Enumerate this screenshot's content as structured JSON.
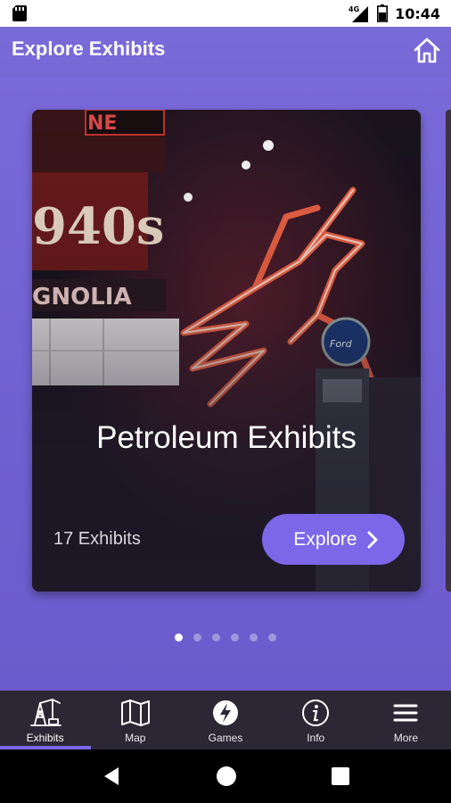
{
  "status_bar": {
    "time": "10:44",
    "network": "4G",
    "icons": [
      "sim-card-icon",
      "signal-icon",
      "battery-icon"
    ]
  },
  "app_bar": {
    "title": "Explore Exhibits",
    "home_icon": "home-icon"
  },
  "carousel": {
    "cards": [
      {
        "title": "Petroleum Exhibits",
        "count": "17 Exhibits",
        "button_label": "Explore",
        "image": "neon-pegasus-photo"
      }
    ],
    "pages": 6,
    "active_page": 0
  },
  "tab_bar": {
    "tabs": [
      {
        "label": "Exhibits",
        "icon": "oil-derrick-icon",
        "active": true
      },
      {
        "label": "Map",
        "icon": "map-icon",
        "active": false
      },
      {
        "label": "Games",
        "icon": "lightning-icon",
        "active": false
      },
      {
        "label": "Info",
        "icon": "info-icon",
        "active": false
      },
      {
        "label": "More",
        "icon": "menu-icon",
        "active": false
      }
    ]
  },
  "colors": {
    "accent": "#7b67e8",
    "background": "#7a6ad8",
    "tab_bar": "#2b2734"
  }
}
